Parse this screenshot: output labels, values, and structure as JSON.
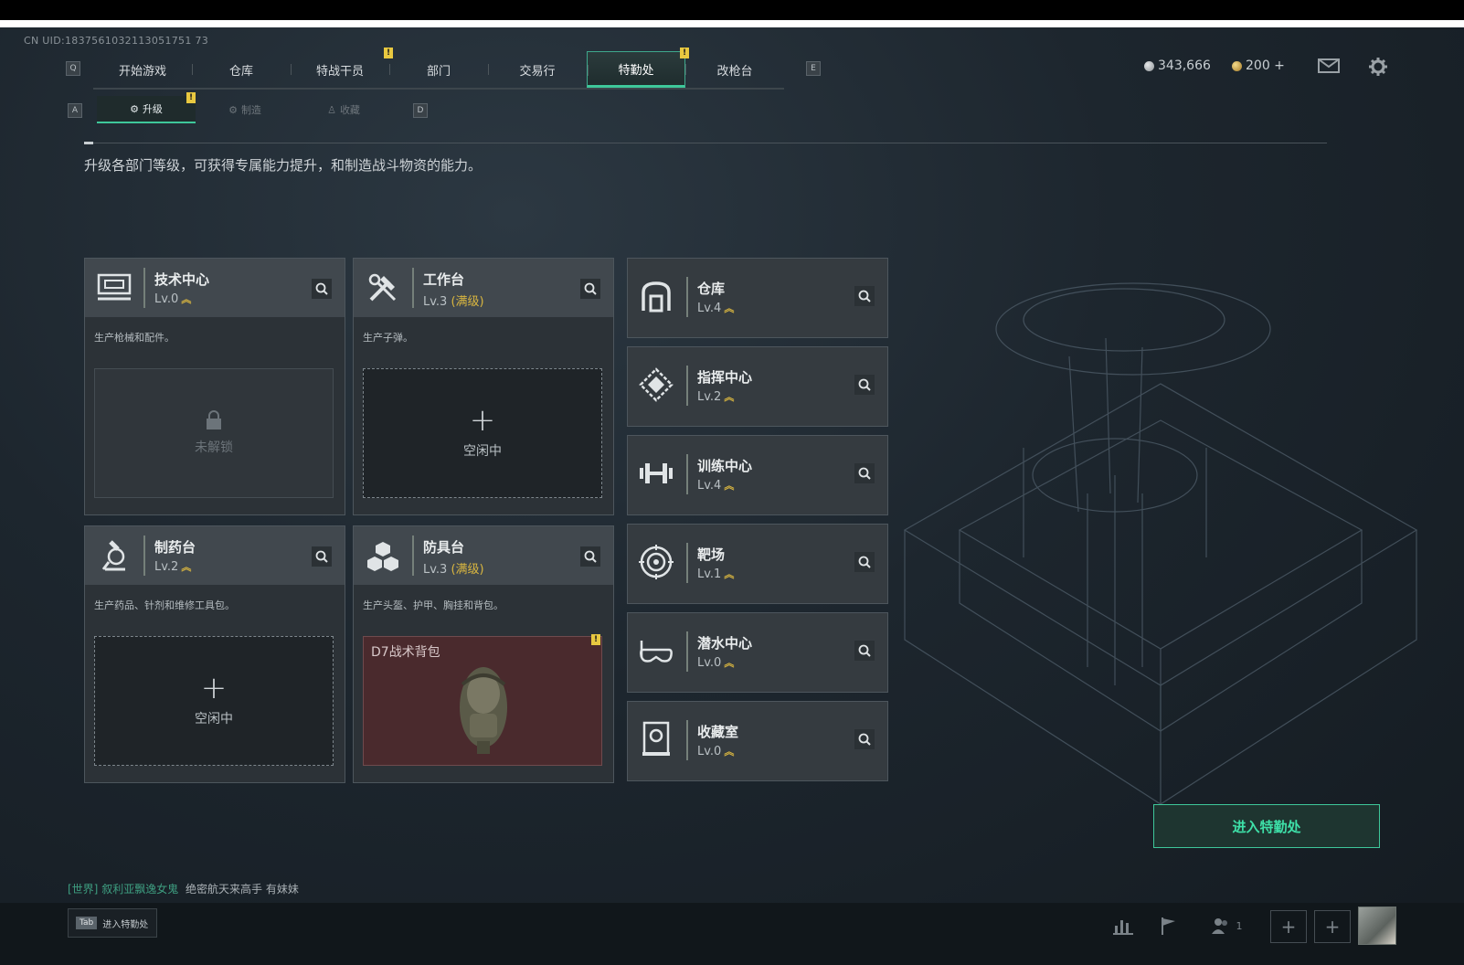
{
  "uid": "CN UID:1837561032113051751 73",
  "nav": {
    "left_key": "Q",
    "right_key": "E",
    "tabs": [
      {
        "label": "开始游戏"
      },
      {
        "label": "仓库"
      },
      {
        "label": "特战干员"
      },
      {
        "label": "部门"
      },
      {
        "label": "交易行"
      },
      {
        "label": "特勤处"
      },
      {
        "label": "改枪台"
      }
    ]
  },
  "currency": {
    "silver": "343,666",
    "gold": "200 +"
  },
  "subtabs": {
    "left_key": "A",
    "right_key": "D",
    "items": [
      {
        "label": "升级"
      },
      {
        "label": "制造"
      },
      {
        "label": "收藏"
      }
    ]
  },
  "description": "升级各部门等级，可获得专属能力提升，和制造战斗物资的能力。",
  "cards": [
    {
      "name": "技术中心",
      "level": "Lv.0",
      "desc": "生产枪械和配件。",
      "slot_label": "未解锁"
    },
    {
      "name": "工作台",
      "level": "Lv.3",
      "maxed": "(满级)",
      "desc": "生产子弹。",
      "slot_plus": "+",
      "slot_label": "空闲中"
    },
    {
      "name": "制药台",
      "level": "Lv.2",
      "desc": "生产药品、针剂和维修工具包。",
      "slot_plus": "+",
      "slot_label": "空闲中"
    },
    {
      "name": "防具台",
      "level": "Lv.3",
      "maxed": "(满级)",
      "desc": "生产头盔、护甲、胸挂和背包。",
      "item_name": "D7战术背包"
    }
  ],
  "side_facilities": [
    {
      "name": "仓库",
      "level": "Lv.4"
    },
    {
      "name": "指挥中心",
      "level": "Lv.2"
    },
    {
      "name": "训练中心",
      "level": "Lv.4"
    },
    {
      "name": "靶场",
      "level": "Lv.1"
    },
    {
      "name": "潜水中心",
      "level": "Lv.0"
    },
    {
      "name": "收藏室",
      "level": "Lv.0"
    }
  ],
  "enter_button": "进入特勤处",
  "chat": {
    "channel": "[世界]",
    "user": "叙利亚飘逸女鬼",
    "message": "绝密航天来高手 有妹妹"
  },
  "bottom": {
    "tab_key": "Tab",
    "tab_label": "进入特勤处",
    "friends_count": "1",
    "add": "+"
  },
  "colors": {
    "accent": "#3ec79a",
    "alert": "#e8c840",
    "maxed": "#d9b640"
  }
}
